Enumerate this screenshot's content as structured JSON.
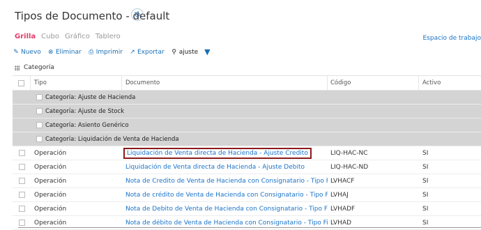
{
  "header": {
    "title": "Tipos de Documento - default",
    "refresh_icon": "refresh-icon"
  },
  "tabs": [
    {
      "label": "Grilla",
      "active": true
    },
    {
      "label": "Cubo",
      "active": false
    },
    {
      "label": "Gráfico",
      "active": false
    },
    {
      "label": "Tablero",
      "active": false
    }
  ],
  "workspace_label": "Espacio de trabajo",
  "toolbar": {
    "new_label": "Nuevo",
    "delete_label": "Eliminar",
    "print_label": "Imprimir",
    "export_label": "Exportar",
    "search_label": "ajuste"
  },
  "group_by": "Categoría",
  "columns": {
    "tipo": "Tipo",
    "documento": "Documento",
    "codigo": "Código",
    "activo": "Activo"
  },
  "groups": [
    "Categoría: Ajuste de Hacienda",
    "Categoría: Ajuste de Stock",
    "Categoría: Asiento Genérico",
    "Categoría: Liquidación de Venta de Hacienda"
  ],
  "rows": [
    {
      "tipo": "Operación",
      "documento": "Liquidación de Venta directa de Hacienda - Ajuste Credito",
      "codigo": "LIQ-HAC-NC",
      "activo": "SI"
    },
    {
      "tipo": "Operación",
      "documento": "Liquidación de Venta directa de Hacienda - Ajuste Debito",
      "codigo": "LIQ-HAC-ND",
      "activo": "SI"
    },
    {
      "tipo": "Operación",
      "documento": "Nota de Credito de Venta de Hacienda con Consignatario - Tipo Fi",
      "codigo": "LVHACF",
      "activo": "SI"
    },
    {
      "tipo": "Operación",
      "documento": "Nota de crédito de Venta de Hacienda con Consignatario - Tipo Fi",
      "codigo": "LVHAJ",
      "activo": "SI"
    },
    {
      "tipo": "Operación",
      "documento": "Nota de Debito de Venta de Hacienda con Consignatario - Tipo Fi",
      "codigo": "LVHADF",
      "activo": "SI"
    },
    {
      "tipo": "Operación",
      "documento": "Nota de débito de Venta de Hacienda con Consignatario - Tipo Fis",
      "codigo": "LVHAD",
      "activo": "SI"
    }
  ],
  "colors": {
    "accent": "#1a73c8",
    "active_tab": "#e23b6c",
    "highlight_border": "#8b1a1a",
    "group_bg": "#d4d4d4"
  }
}
